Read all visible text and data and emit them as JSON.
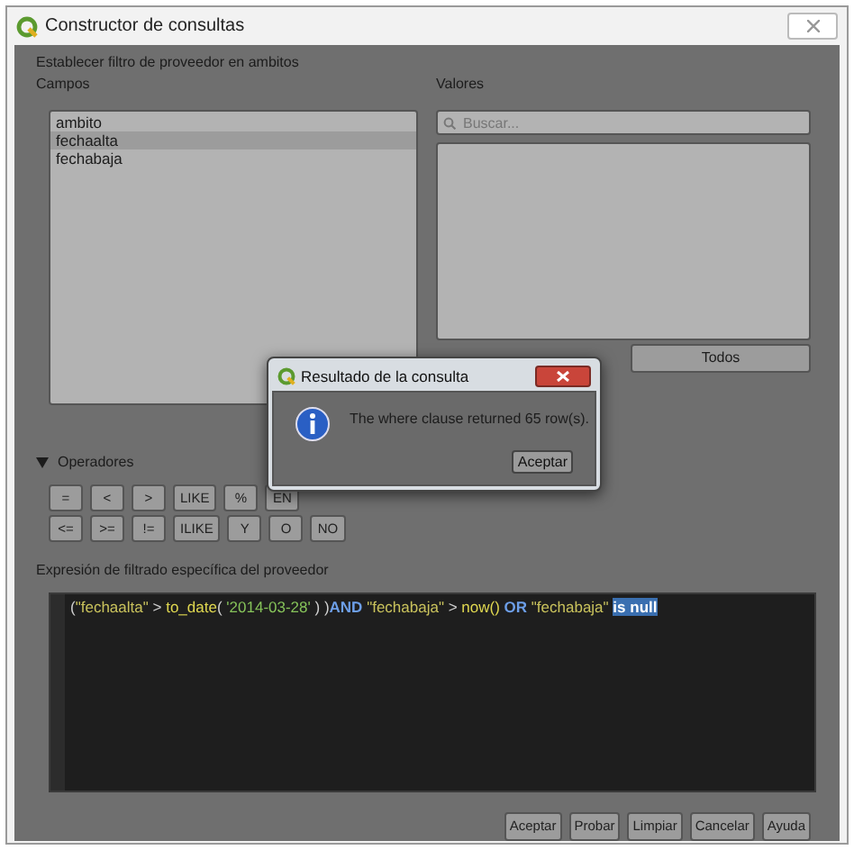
{
  "window": {
    "title": "Constructor de consultas"
  },
  "heading": "Establecer filtro de proveedor en ambitos",
  "fields": {
    "label": "Campos",
    "items": [
      {
        "text": "ambito",
        "selected": false
      },
      {
        "text": "fechaalta",
        "selected": true
      },
      {
        "text": "fechabaja",
        "selected": false
      }
    ]
  },
  "values": {
    "label": "Valores",
    "search": {
      "placeholder": "Buscar..."
    },
    "buttons": [
      "Todos"
    ]
  },
  "operators": {
    "label": "Operadores",
    "expanded": true,
    "rows": [
      [
        "=",
        "<",
        ">",
        "LIKE",
        "%",
        "EN"
      ],
      [
        "<=",
        ">=",
        "!=",
        "ILIKE",
        "Y",
        "O",
        "NO"
      ]
    ]
  },
  "expression": {
    "label": "Expresión de filtrado específica del proveedor",
    "tokens": [
      {
        "text": "(",
        "kind": "operator",
        "selected": false
      },
      {
        "text": "\"fechaalta\"",
        "kind": "field",
        "selected": false
      },
      {
        "text": " > ",
        "kind": "operator",
        "selected": false
      },
      {
        "text": "to_date",
        "kind": "function",
        "selected": false
      },
      {
        "text": "( ",
        "kind": "operator",
        "selected": false
      },
      {
        "text": "'2014-03-28'",
        "kind": "string",
        "selected": false
      },
      {
        "text": " ) )",
        "kind": "operator",
        "selected": false
      },
      {
        "text": "AND ",
        "kind": "keyword",
        "selected": false
      },
      {
        "text": "\"fechabaja\"",
        "kind": "field",
        "selected": false
      },
      {
        "text": " > ",
        "kind": "operator",
        "selected": false
      },
      {
        "text": "now()",
        "kind": "function",
        "selected": false
      },
      {
        "text": " OR ",
        "kind": "keyword",
        "selected": false
      },
      {
        "text": "\"fechabaja\" ",
        "kind": "field",
        "selected": false
      },
      {
        "text": "is null",
        "kind": "keyword",
        "selected": true
      }
    ]
  },
  "buttons": [
    "Aceptar",
    "Probar",
    "Limpiar",
    "Cancelar",
    "Ayuda"
  ],
  "dialog": {
    "title": "Resultado de la consulta",
    "message": "The where clause returned 65 row(s).",
    "button": "Aceptar"
  }
}
